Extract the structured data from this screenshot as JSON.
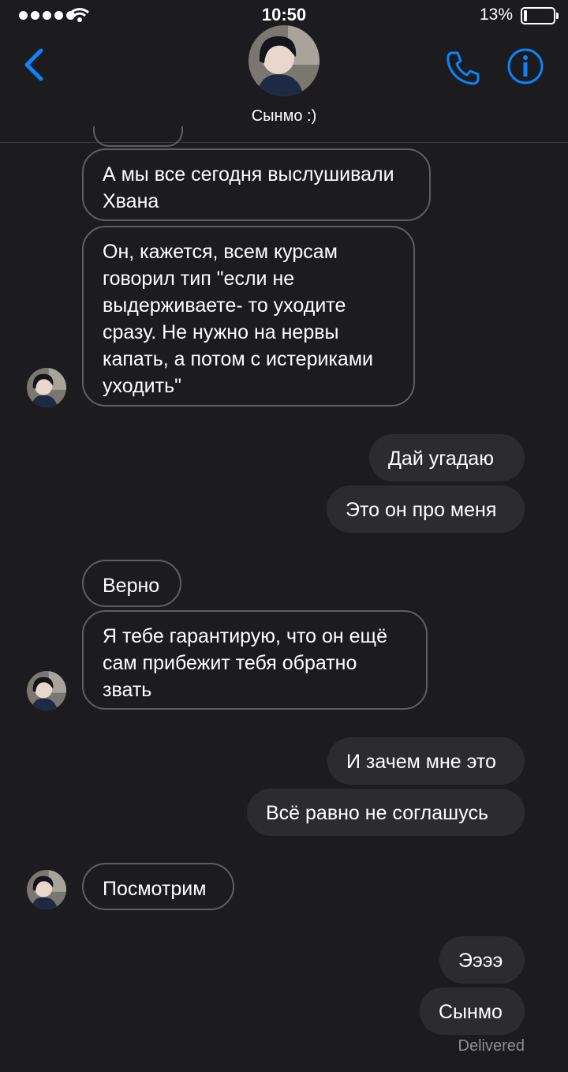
{
  "status_bar": {
    "time": "10:50",
    "battery": "13%"
  },
  "header": {
    "contact_name": "Сынмо :)"
  },
  "messages": [
    {
      "text": "А мы все сегодня выслушивали\nХвана"
    },
    {
      "text": "Он, кажется, всем курсам\nговорил тип \"если не\nвыдерживаете- то уходите\nсразу. Не нужно на нервы\nкапать, а потом с истериками\nуходить\""
    },
    {
      "text": "Дай угадаю"
    },
    {
      "text": "Это он про меня"
    },
    {
      "text": "Верно"
    },
    {
      "text": "Я тебе гарантирую, что он ещё\nсам прибежит тебя обратно\nзвать"
    },
    {
      "text": "И зачем мне это"
    },
    {
      "text": "Всё равно не соглашусь"
    },
    {
      "text": "Посмотрим"
    },
    {
      "text": "Ээээ"
    },
    {
      "text": "Сынмо"
    }
  ],
  "delivered_label": "Delivered",
  "colors": {
    "accent": "#0a84ff",
    "background": "#1c1c1e",
    "outgoing_bubble": "#2c2c2e",
    "incoming_border": "#5e5e62"
  }
}
